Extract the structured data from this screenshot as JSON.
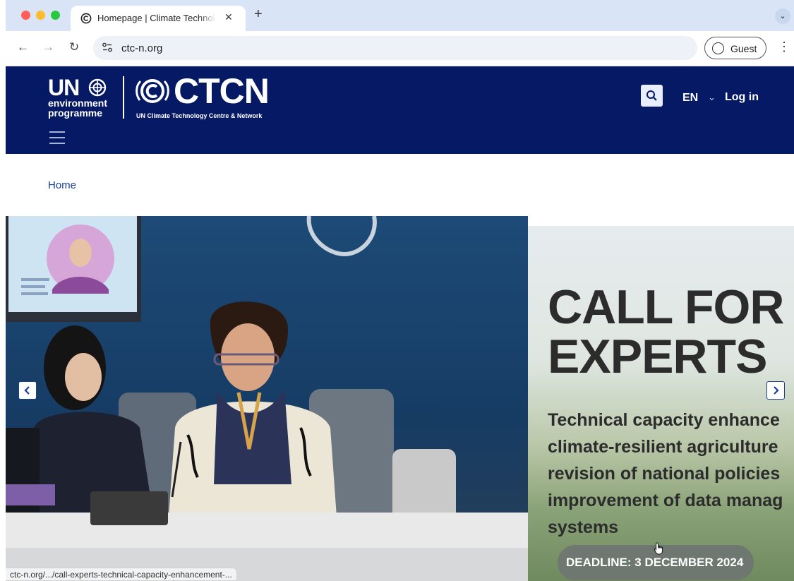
{
  "browser": {
    "tab": {
      "title": "Homepage | Climate Technolo",
      "close_glyph": "✕",
      "favicon": "copyright-icon"
    },
    "new_tab_glyph": "+",
    "tab_search_glyph": "⌄",
    "address": {
      "url": "ctc-n.org",
      "site_info_glyph": "⚙"
    },
    "nav": {
      "back_glyph": "←",
      "forward_glyph": "→",
      "reload_glyph": "↻"
    },
    "profile": {
      "label": "Guest"
    },
    "menu_glyph": "⋮",
    "status_url": "ctc-n.org/.../call-experts-technical-capacity-enhancement-..."
  },
  "header": {
    "unep": {
      "un": "UN",
      "line1": "environment",
      "line2": "programme"
    },
    "ctcn": {
      "name": "CTCN",
      "tagline": "UN Climate Technology Centre & Network"
    },
    "language": "EN",
    "language_chevron": "⌄",
    "login_label": "Log in",
    "colors": {
      "background": "#061965",
      "accent": "#1a3e9e"
    }
  },
  "breadcrumb": {
    "home": "Home"
  },
  "carousel": {
    "promo": {
      "title_line1": "CALL FOR",
      "title_line2": "EXPERTS",
      "body_lines": [
        "Technical capacity enhance",
        "climate-resilient agriculture",
        "revision of national policies",
        "improvement of data manag",
        "systems"
      ],
      "deadline": "DEADLINE: 3 DECEMBER 2024"
    },
    "prev_glyph": "‹",
    "next_glyph": "›"
  }
}
